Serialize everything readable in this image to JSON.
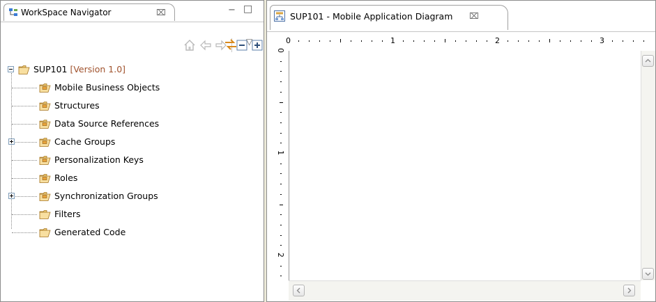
{
  "navigator": {
    "tab_title": "WorkSpace Navigator",
    "close_symbol": "⌧",
    "minimize_symbol": "−",
    "maximize_symbol": "□",
    "view_menu_symbol": "▽",
    "toolbar": {
      "home_icon": "home-icon",
      "back_icon": "back-arrow-icon",
      "forward_icon": "forward-arrow-icon",
      "collapse_icon": "collapse-all-icon",
      "expand_icon": "expand-all-icon",
      "link_icon": "link-with-editor-icon"
    },
    "tree": {
      "root": {
        "label": "SUP101",
        "version": "[Version 1.0]",
        "expanded": true
      },
      "children": [
        {
          "label": "Mobile Business Objects",
          "expandable": false
        },
        {
          "label": "Structures",
          "expandable": false
        },
        {
          "label": "Data Source References",
          "expandable": false
        },
        {
          "label": "Cache Groups",
          "expandable": true
        },
        {
          "label": "Personalization Keys",
          "expandable": false
        },
        {
          "label": "Roles",
          "expandable": false
        },
        {
          "label": "Synchronization Groups",
          "expandable": true
        },
        {
          "label": "Filters",
          "expandable": false
        },
        {
          "label": "Generated Code",
          "expandable": false
        }
      ]
    }
  },
  "editor": {
    "tab_title": "SUP101 - Mobile Application Diagram",
    "close_symbol": "⌧",
    "ruler_h_labels": [
      "0",
      "1",
      "2",
      "3"
    ],
    "ruler_v_labels": [
      "0",
      "1",
      "2"
    ]
  },
  "colors": {
    "version_text": "#a0522d",
    "folder_orange": "#e8a33a",
    "border": "#8c8c8c"
  }
}
